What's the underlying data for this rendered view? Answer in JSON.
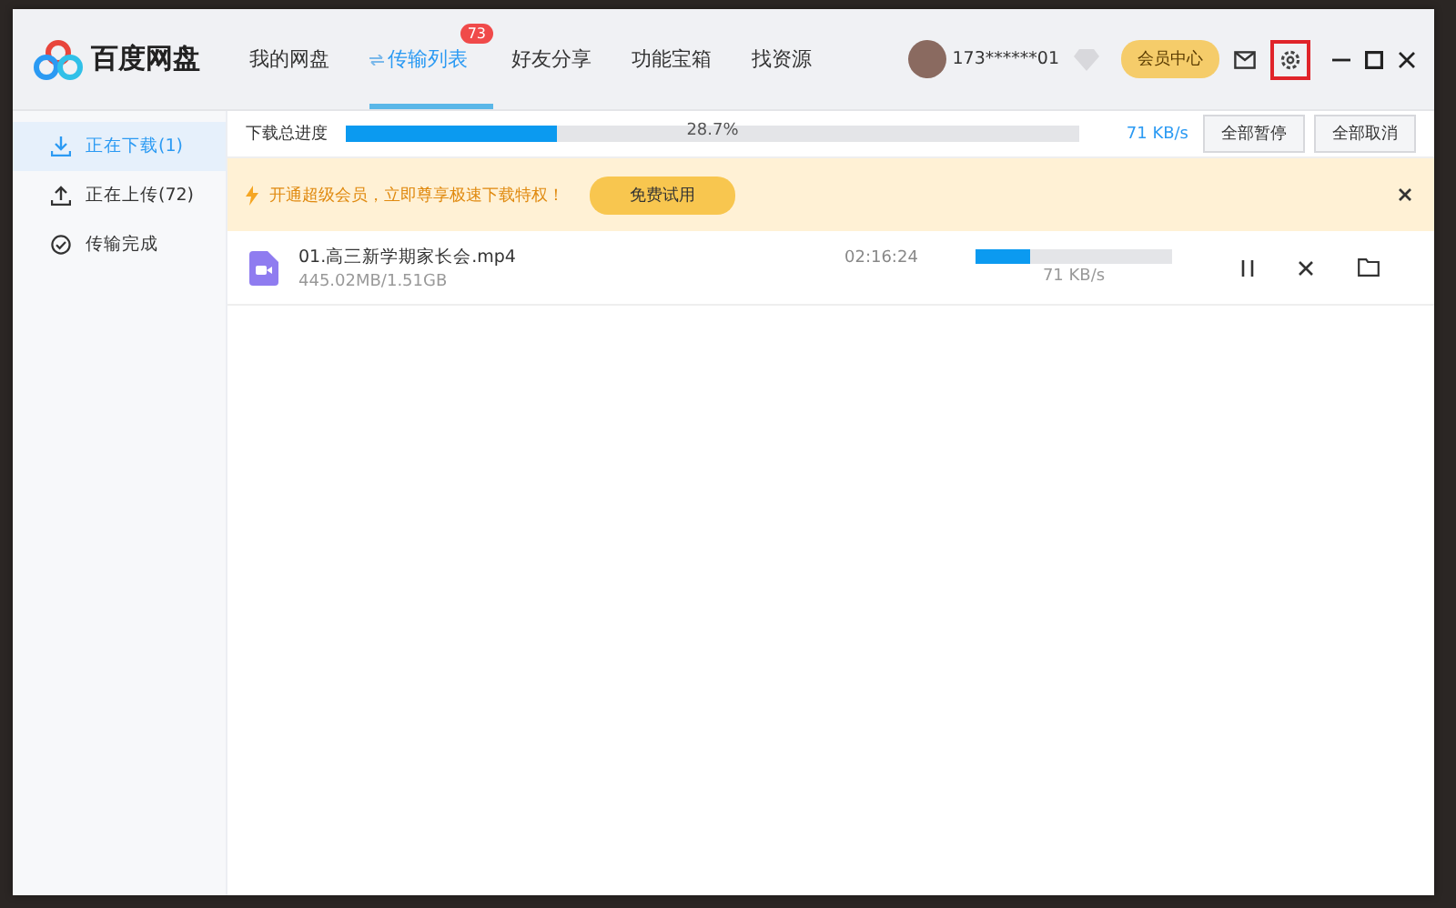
{
  "app": {
    "name": "百度网盘"
  },
  "tabs": [
    {
      "label": "我的网盘",
      "selected": false
    },
    {
      "label": "传输列表",
      "selected": true,
      "badge": "73"
    },
    {
      "label": "好友分享",
      "selected": false
    },
    {
      "label": "功能宝箱",
      "selected": false
    },
    {
      "label": "找资源",
      "selected": false
    }
  ],
  "user": {
    "name": "173******01",
    "vip_button": "会员中心"
  },
  "sidebar": {
    "items": [
      {
        "label": "正在下载(1)",
        "kind": "download",
        "selected": true
      },
      {
        "label": "正在上传(72)",
        "kind": "upload",
        "selected": false
      },
      {
        "label": "传输完成",
        "kind": "done",
        "selected": false
      }
    ]
  },
  "total": {
    "label": "下载总进度",
    "level": 0.287,
    "percent": "28.7%",
    "speed": "71 KB/s",
    "buttons": [
      "全部暂停",
      "全部取消"
    ]
  },
  "banner": {
    "text": "开通超级会员，立即尊享极速下载特权！",
    "button": "免费试用"
  },
  "downloads": [
    {
      "name": "01.高三新学期家长会.mp4",
      "size": "445.02MB/1.51GB",
      "time_left": "02:16:24",
      "level": 0.28,
      "speed": "71 KB/s"
    }
  ]
}
